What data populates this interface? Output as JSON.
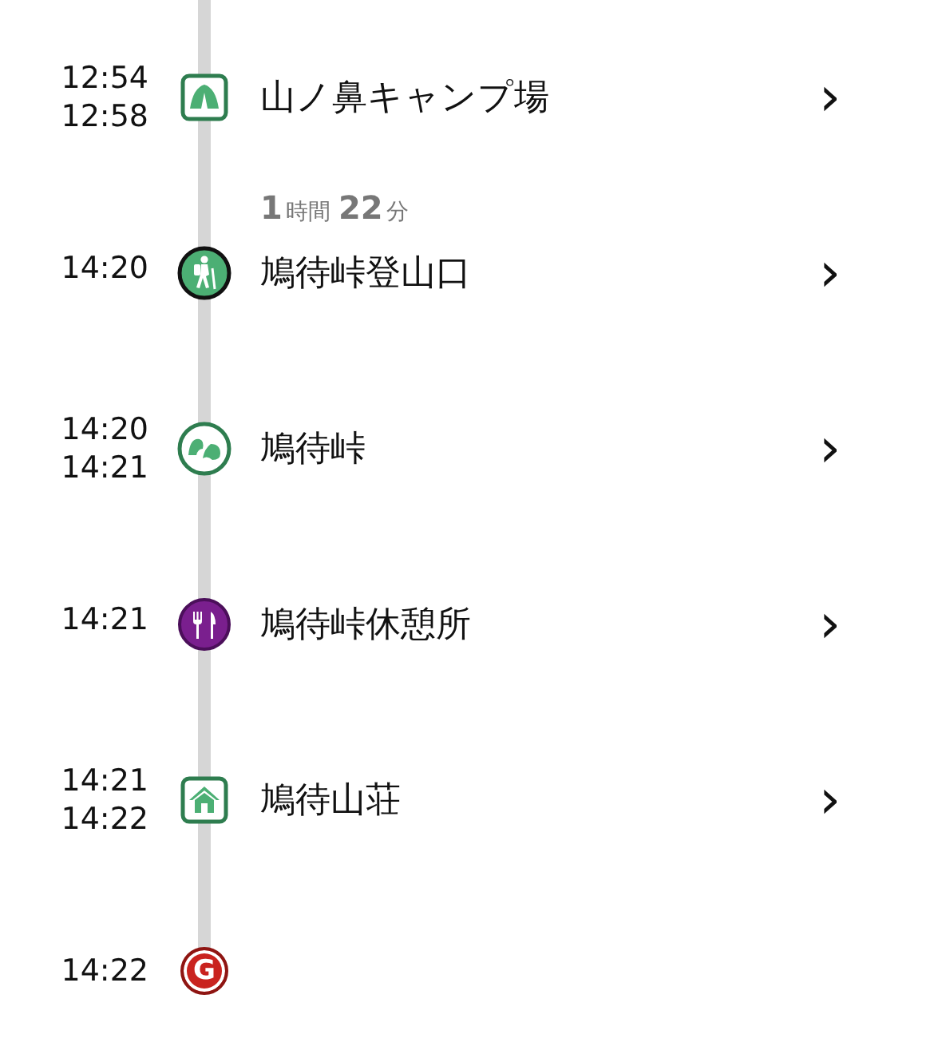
{
  "stops": [
    {
      "kind": "camp",
      "times": [
        "12:54",
        "12:58"
      ],
      "name": "山ノ鼻キャンプ場",
      "chevron": "›"
    },
    {
      "kind": "trailhead",
      "times": [
        "14:20"
      ],
      "name": "鳩待峠登山口",
      "chevron": "›",
      "duration_before": {
        "hours": "1",
        "hours_unit": "時間",
        "minutes": "22",
        "minutes_unit": "分"
      }
    },
    {
      "kind": "pass",
      "times": [
        "14:20",
        "14:21"
      ],
      "name": "鳩待峠",
      "chevron": "›"
    },
    {
      "kind": "rest",
      "times": [
        "14:21"
      ],
      "name": "鳩待峠休憩所",
      "chevron": "›"
    },
    {
      "kind": "hut",
      "times": [
        "14:21",
        "14:22"
      ],
      "name": "鳩待山荘",
      "chevron": "›"
    },
    {
      "kind": "goal",
      "times": [
        "14:22"
      ],
      "badge": "G"
    }
  ]
}
